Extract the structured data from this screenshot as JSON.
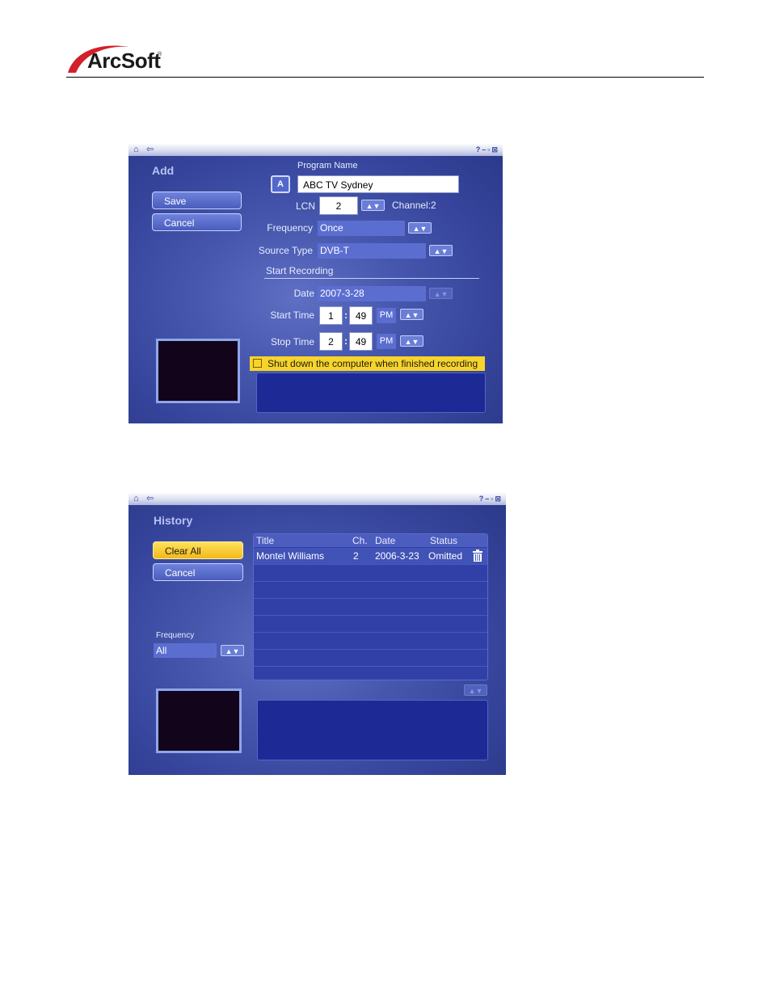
{
  "header": {
    "logo_text": "ArcSoft",
    "logo_reg": "®"
  },
  "add_window": {
    "title": "Add",
    "save_label": "Save",
    "cancel_label": "Cancel",
    "program_name_label": "Program Name",
    "program_name_value": "ABC TV Sydney",
    "keyboard_button": "A",
    "lcn_label": "LCN",
    "lcn_value": "2",
    "channel_text": "Channel:2",
    "frequency_label": "Frequency",
    "frequency_value": "Once",
    "source_type_label": "Source Type",
    "source_type_value": "DVB-T",
    "start_recording_label": "Start Recording",
    "date_label": "Date",
    "date_value": "2007-3-28",
    "start_time_label": "Start Time",
    "start_hour": "1",
    "start_minute": "49",
    "start_ampm": "PM",
    "stop_time_label": "Stop Time",
    "stop_hour": "2",
    "stop_minute": "49",
    "stop_ampm": "PM",
    "shutdown_label": "Shut down the computer when finished recording"
  },
  "history_window": {
    "title": "History",
    "clear_all_label": "Clear All",
    "cancel_label": "Cancel",
    "frequency_label": "Frequency",
    "frequency_value": "All",
    "columns": [
      "Title",
      "Ch.",
      "Date",
      "Status"
    ],
    "rows": [
      {
        "title": "Montel Williams",
        "ch": "2",
        "date": "2006-3-23",
        "status": "Omitted"
      }
    ]
  },
  "icons": {
    "home": "home-icon",
    "back": "back-arrow-icon",
    "help": "help-icon",
    "minimize": "minimize-icon",
    "restore": "restore-icon",
    "close": "close-icon",
    "updown": "up-down-arrows-icon",
    "trash": "trash-icon"
  },
  "colors": {
    "window_bg": "#4657ad",
    "warning_bg": "#f7d42a",
    "highlight_button": "#f2b81a",
    "logo_red": "#d3202a"
  }
}
